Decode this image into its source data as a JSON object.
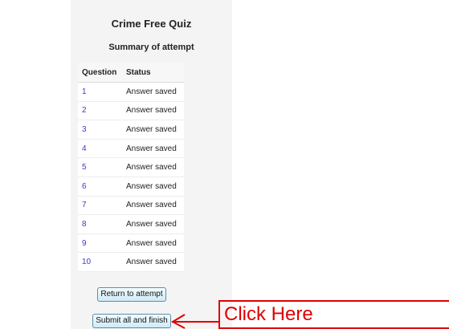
{
  "quiz": {
    "title": "Crime Free Quiz",
    "summary_title": "Summary of attempt"
  },
  "table": {
    "headers": {
      "question": "Question",
      "status": "Status"
    },
    "rows": [
      {
        "question": "1",
        "status": "Answer saved"
      },
      {
        "question": "2",
        "status": "Answer saved"
      },
      {
        "question": "3",
        "status": "Answer saved"
      },
      {
        "question": "4",
        "status": "Answer saved"
      },
      {
        "question": "5",
        "status": "Answer saved"
      },
      {
        "question": "6",
        "status": "Answer saved"
      },
      {
        "question": "7",
        "status": "Answer saved"
      },
      {
        "question": "8",
        "status": "Answer saved"
      },
      {
        "question": "9",
        "status": "Answer saved"
      },
      {
        "question": "10",
        "status": "Answer saved"
      }
    ]
  },
  "buttons": {
    "return_label": "Return to attempt",
    "submit_label": "Submit all and finish"
  },
  "annotation": {
    "label": "Click Here",
    "color": "#e00000"
  },
  "colors": {
    "link": "#3a3acc",
    "panel_background": "#f4f4f4",
    "button_border": "#5a8fa8"
  }
}
